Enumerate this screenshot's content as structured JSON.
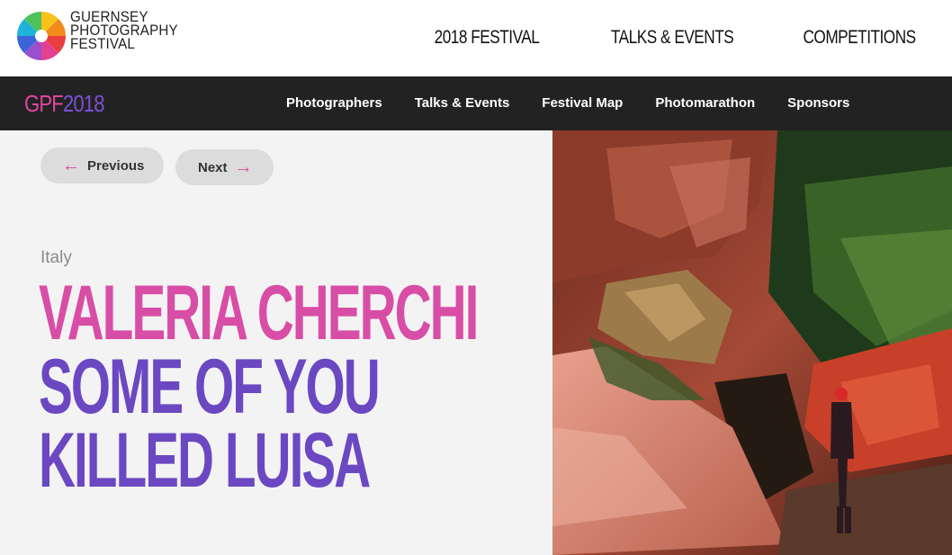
{
  "brand": {
    "logo_lines": [
      "GUERNSEY",
      "PHOTOGRAPHY",
      "FESTIVAL"
    ],
    "badge_part1": "GPF",
    "badge_part2": "2018"
  },
  "top_nav": [
    {
      "label": "2018 FESTIVAL"
    },
    {
      "label": "TALKS & EVENTS"
    },
    {
      "label": "COMPETITIONS"
    }
  ],
  "sub_nav": [
    {
      "label": "Photographers"
    },
    {
      "label": "Talks & Events"
    },
    {
      "label": "Festival Map"
    },
    {
      "label": "Photomarathon"
    },
    {
      "label": "Sponsors"
    }
  ],
  "pager": {
    "previous_label": "Previous",
    "next_label": "Next"
  },
  "photographer": {
    "country": "Italy",
    "name": "VALERIA CHERCHI",
    "work_line1": "SOME OF YOU",
    "work_line2": "KILLED LUISA"
  },
  "colors": {
    "accent_pink": "#e0469e",
    "accent_purple": "#6b48c2",
    "bar_dark": "#222222"
  }
}
